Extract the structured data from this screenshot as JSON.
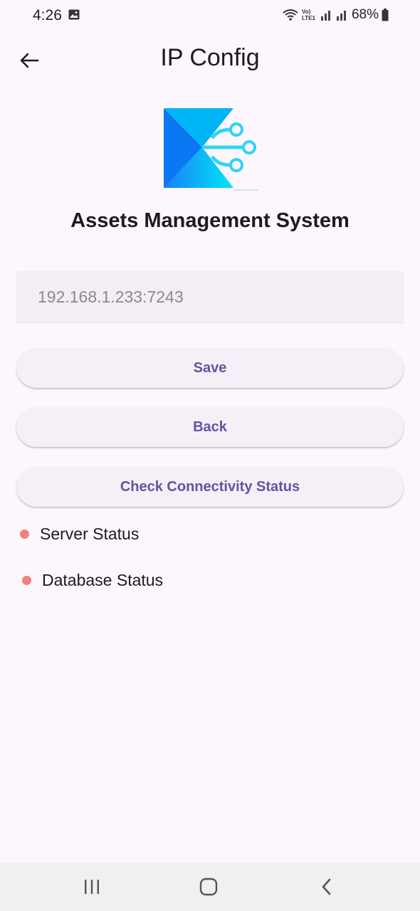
{
  "status_bar": {
    "time": "4:26",
    "network_label": "Vo) LTE1",
    "battery": "68%"
  },
  "app_bar": {
    "title": "IP Config"
  },
  "header": {
    "app_name": "Assets Management System"
  },
  "ip_input": {
    "placeholder": "192.168.1.233:7243",
    "value": ""
  },
  "buttons": {
    "save": "Save",
    "back": "Back",
    "check": "Check Connectivity Status"
  },
  "status": {
    "server": "Server Status",
    "database": "Database Status",
    "indicator_color": "#f08080"
  },
  "colors": {
    "background": "#fdf7fd",
    "accent": "#6750a4",
    "field_bg": "#f3eef4"
  }
}
